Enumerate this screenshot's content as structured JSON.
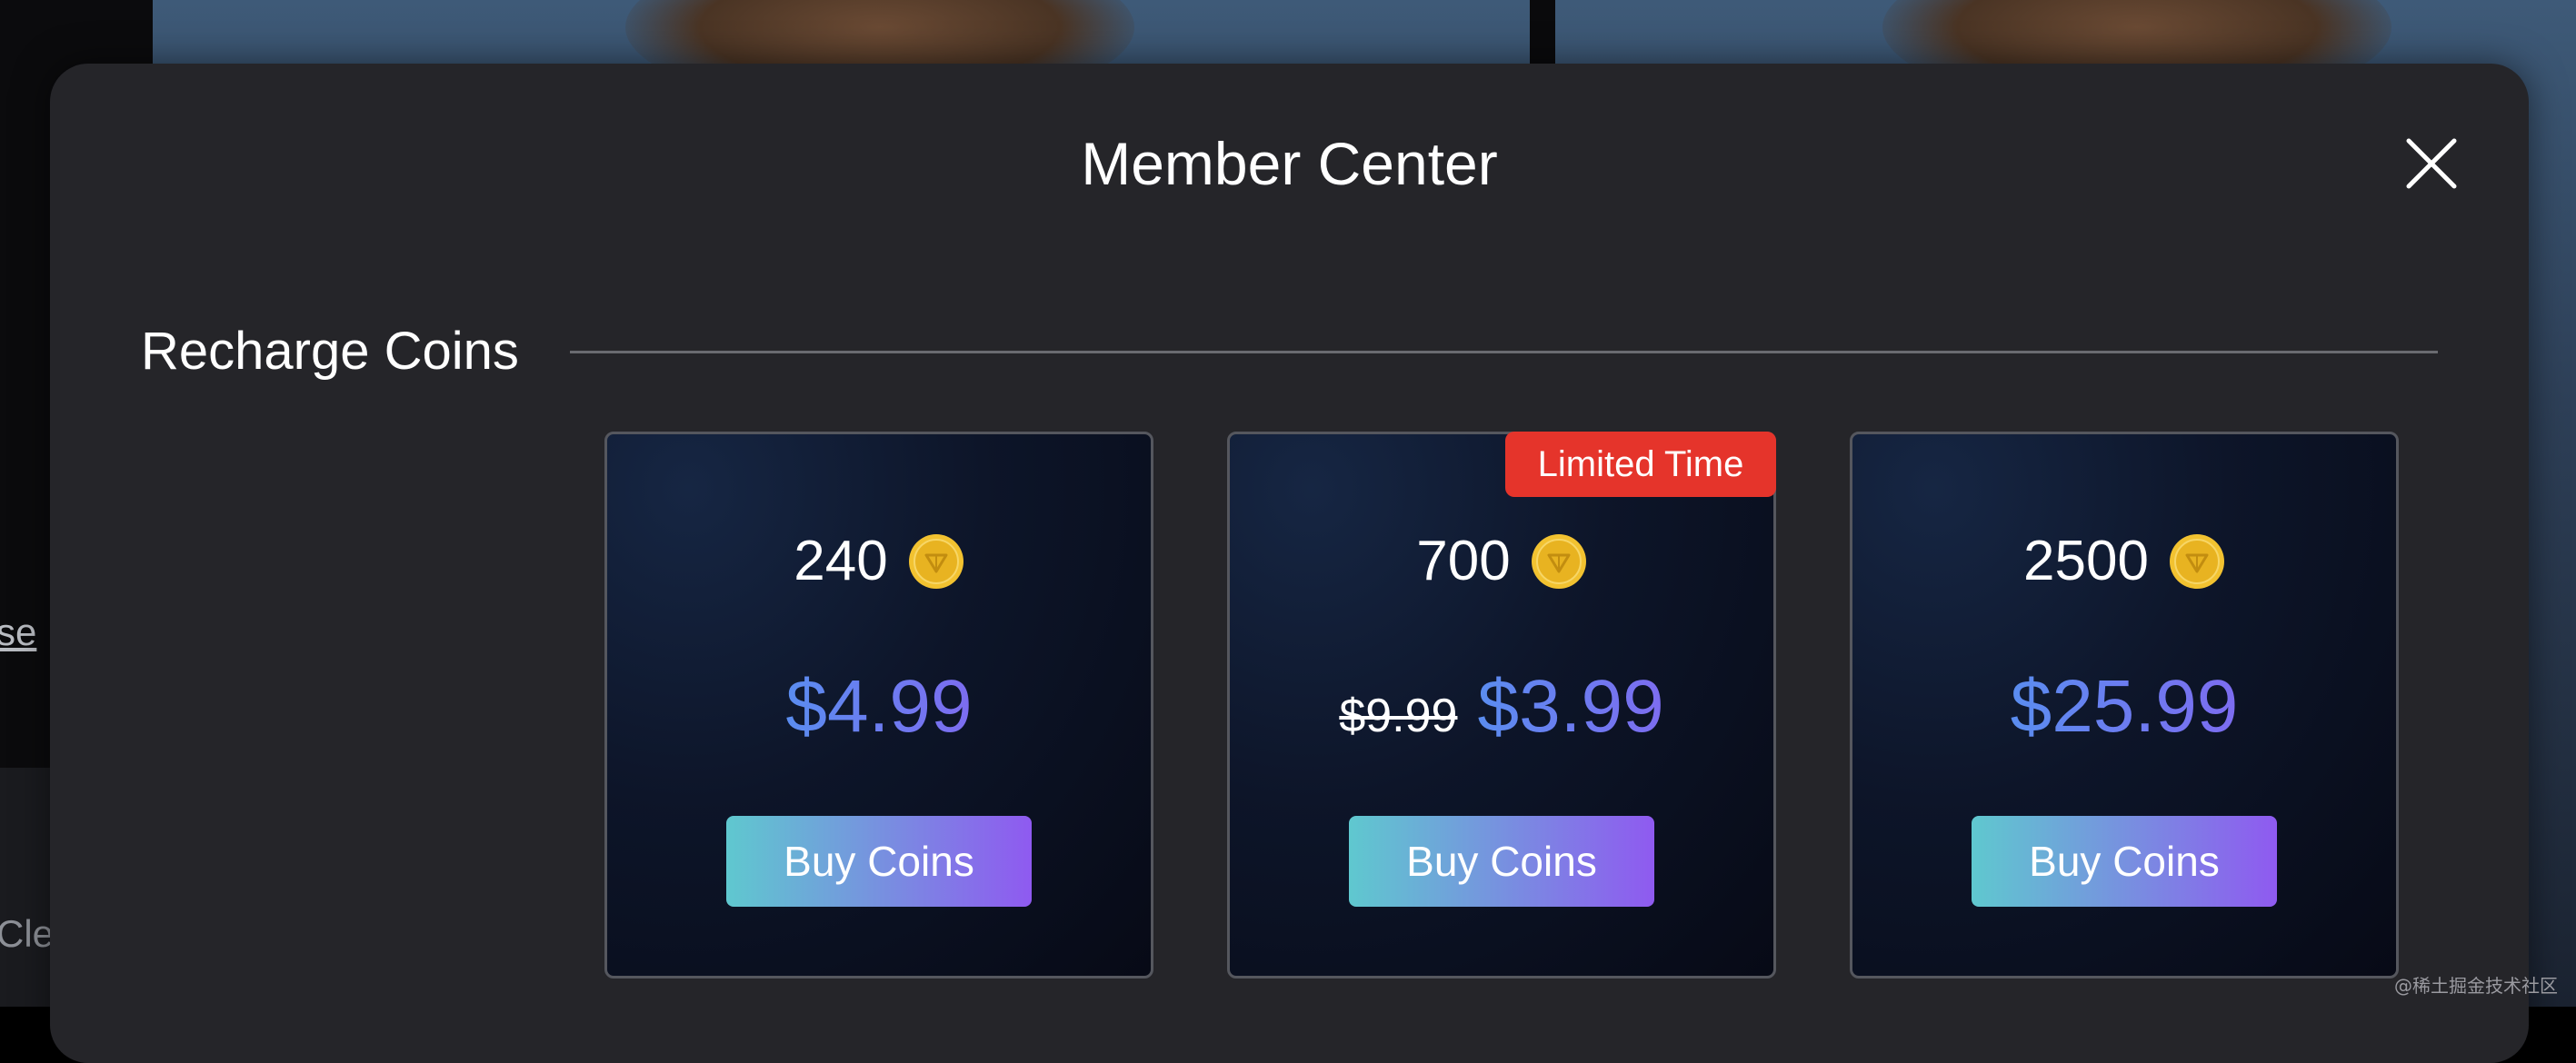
{
  "background": {
    "peek_text_1": "se",
    "peek_text_2": "Clea"
  },
  "modal": {
    "title": "Member Center",
    "close_icon": "close-icon"
  },
  "section": {
    "title": "Recharge Coins"
  },
  "packages": [
    {
      "coins": "240",
      "price": "$4.99",
      "old_price": "",
      "badge": "",
      "button_label": "Buy Coins"
    },
    {
      "coins": "700",
      "price": "$3.99",
      "old_price": "$9.99",
      "badge": "Limited Time",
      "button_label": "Buy Coins"
    },
    {
      "coins": "2500",
      "price": "$25.99",
      "old_price": "",
      "badge": "",
      "button_label": "Buy Coins"
    }
  ],
  "colors": {
    "modal_bg": "#252529",
    "badge": "#e5342b",
    "button_gradient_start": "#5fc8cf",
    "button_gradient_end": "#8f5af0",
    "price_gradient_start": "#5a8df0",
    "price_gradient_end": "#7d6cf0",
    "coin": "#f2c230"
  },
  "watermark": "@稀土掘金技术社区"
}
